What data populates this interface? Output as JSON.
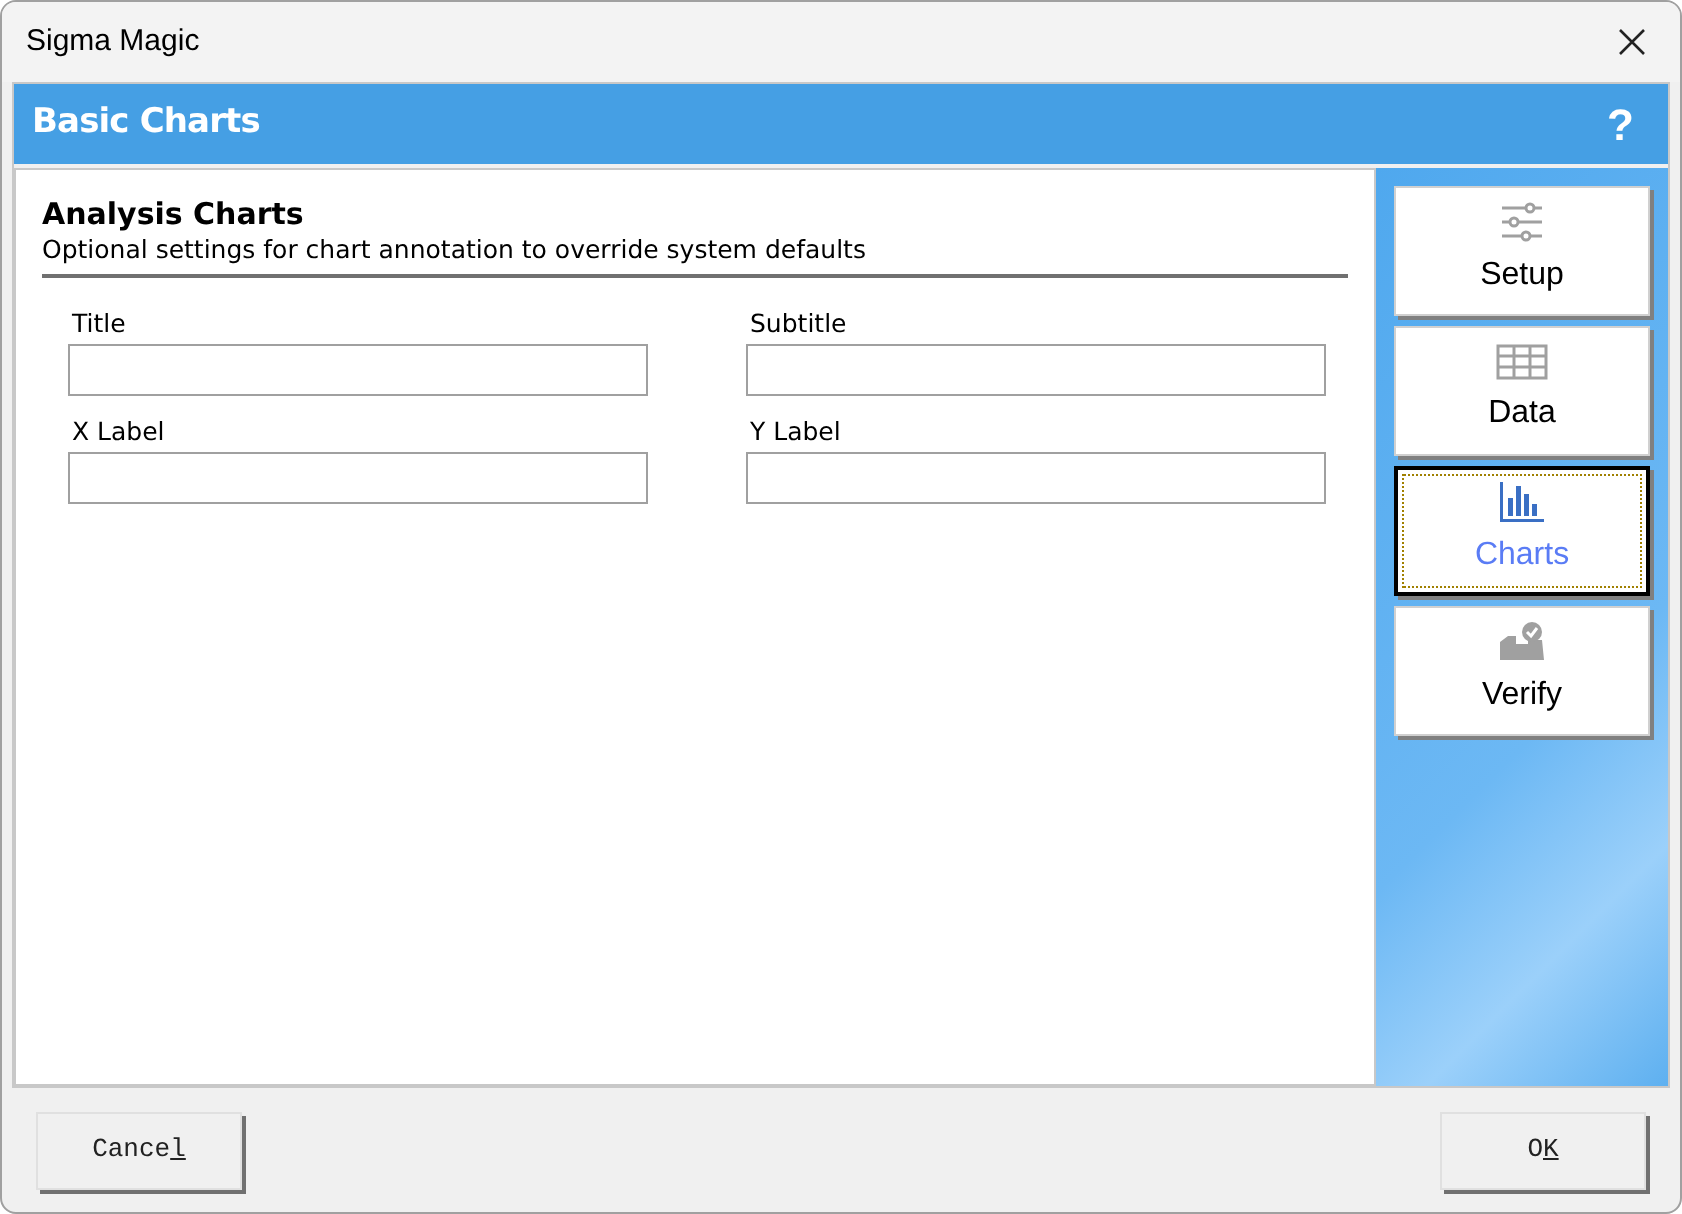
{
  "window": {
    "title": "Sigma Magic"
  },
  "header": {
    "title": "Basic Charts",
    "help": "?"
  },
  "section": {
    "title": "Analysis Charts",
    "subtitle": "Optional settings for chart annotation to override system defaults"
  },
  "fields": [
    {
      "label": "Title"
    },
    {
      "label": "Subtitle"
    },
    {
      "label": "X Label"
    },
    {
      "label": "Y Label"
    }
  ],
  "nav": [
    {
      "label": "Setup",
      "kind": "sliders",
      "selected": false
    },
    {
      "label": "Data",
      "kind": "table",
      "selected": false
    },
    {
      "label": "Charts",
      "kind": "chart",
      "selected": true
    },
    {
      "label": "Verify",
      "kind": "verify",
      "selected": false
    }
  ],
  "buttons": [
    {
      "text": "Cance",
      "mnemonic": "l"
    },
    {
      "text": "O",
      "mnemonic": "K"
    }
  ]
}
